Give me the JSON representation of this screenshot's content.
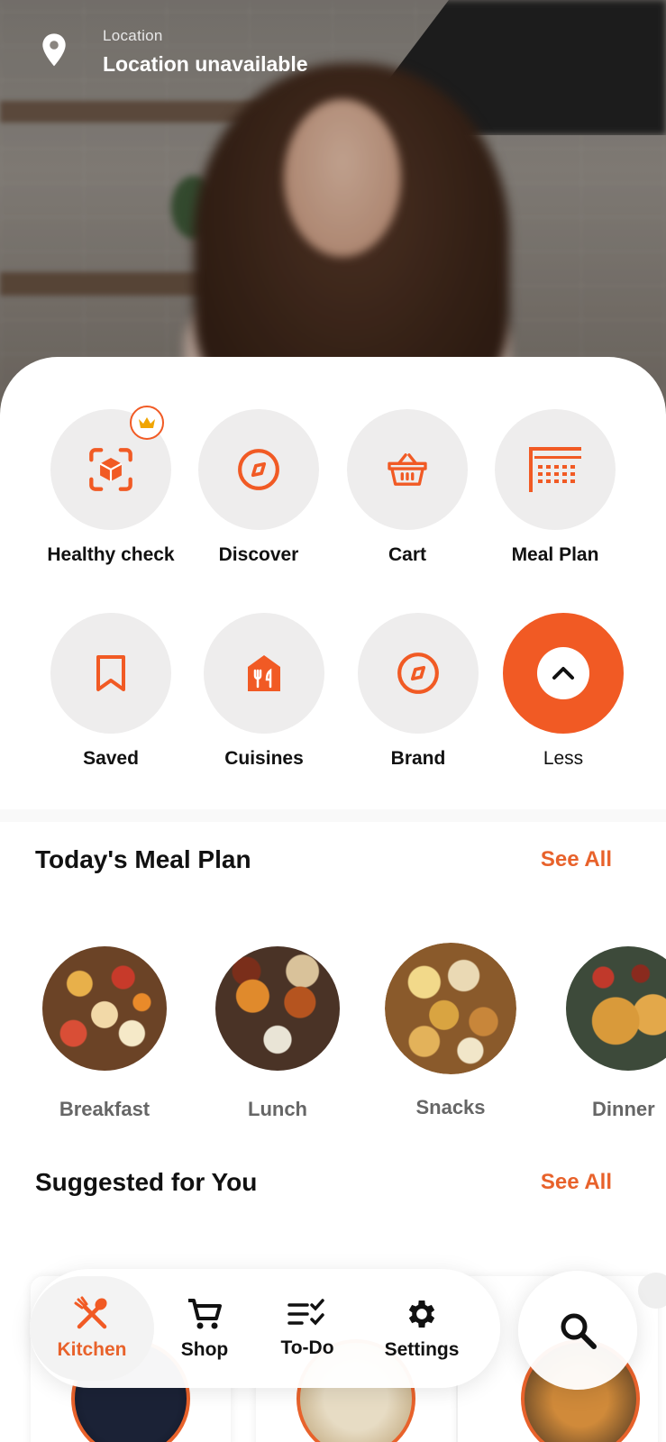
{
  "location": {
    "label": "Location",
    "value": "Location unavailable",
    "icon": "map-pin-icon"
  },
  "categories": [
    {
      "label": "Healthy check",
      "icon": "scan-box-icon",
      "premium": true
    },
    {
      "label": "Discover",
      "icon": "compass-icon"
    },
    {
      "label": "Cart",
      "icon": "basket-icon"
    },
    {
      "label": "Meal Plan",
      "icon": "calendar-grid-icon"
    },
    {
      "label": "Saved",
      "icon": "bookmark-icon"
    },
    {
      "label": "Cuisines",
      "icon": "restaurant-house-icon"
    },
    {
      "label": "Brand",
      "icon": "compass-icon"
    },
    {
      "label": "Less",
      "icon": "chevron-up-icon"
    }
  ],
  "meal_plan": {
    "title": "Today's Meal Plan",
    "see_all": "See All",
    "items": [
      {
        "label": "Breakfast"
      },
      {
        "label": "Lunch"
      },
      {
        "label": "Snacks"
      },
      {
        "label": "Dinner"
      }
    ]
  },
  "suggested": {
    "title": "Suggested for You",
    "see_all": "See All"
  },
  "nav": {
    "items": [
      {
        "label": "Kitchen",
        "icon": "fork-spoon-icon",
        "active": true
      },
      {
        "label": "Shop",
        "icon": "cart-icon"
      },
      {
        "label": "To-Do",
        "icon": "checklist-icon"
      },
      {
        "label": "Settings",
        "icon": "gear-icon"
      }
    ],
    "search_icon": "search-icon"
  },
  "colors": {
    "accent": "#f15a24",
    "accent_text": "#e8622b",
    "circle_bg": "#eeeded"
  }
}
